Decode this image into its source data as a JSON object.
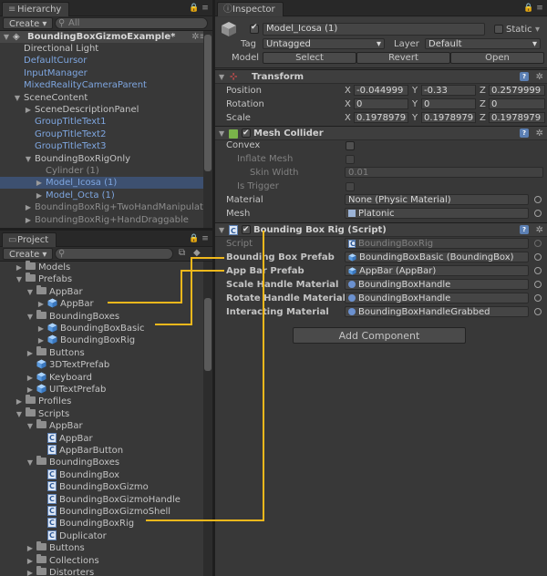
{
  "hierarchy": {
    "tab": "Hierarchy",
    "create": "Create",
    "search_placeholder": "All",
    "scene": "BoundingBoxGizmoExample*",
    "items": [
      {
        "label": "Directional Light",
        "style": "normal",
        "indent": 1
      },
      {
        "label": "DefaultCursor",
        "style": "blue",
        "indent": 1
      },
      {
        "label": "InputManager",
        "style": "blue",
        "indent": 1
      },
      {
        "label": "MixedRealityCameraParent",
        "style": "blue",
        "indent": 1
      },
      {
        "label": "SceneContent",
        "style": "normal",
        "indent": 1
      },
      {
        "label": "SceneDescriptionPanel",
        "style": "normal",
        "indent": 2
      },
      {
        "label": "GroupTitleText1",
        "style": "blue",
        "indent": 2
      },
      {
        "label": "GroupTitleText2",
        "style": "blue",
        "indent": 2
      },
      {
        "label": "GroupTitleText3",
        "style": "blue",
        "indent": 2
      },
      {
        "label": "BoundingBoxRigOnly",
        "style": "normal",
        "indent": 2
      },
      {
        "label": "Cylinder (1)",
        "style": "grey",
        "indent": 3
      },
      {
        "label": "Model_Icosa (1)",
        "style": "blue",
        "indent": 3
      },
      {
        "label": "Model_Octa (1)",
        "style": "blue",
        "indent": 3
      },
      {
        "label": "BoundingBoxRig+TwoHandManipulatable",
        "style": "grey",
        "indent": 2
      },
      {
        "label": "BoundingBoxRig+HandDraggable",
        "style": "grey",
        "indent": 2
      }
    ]
  },
  "project": {
    "tab": "Project",
    "create": "Create",
    "items": [
      {
        "label": "Models",
        "kind": "folder",
        "indent": 1
      },
      {
        "label": "Prefabs",
        "kind": "folder",
        "indent": 1
      },
      {
        "label": "AppBar",
        "kind": "folder",
        "indent": 2
      },
      {
        "label": "AppBar",
        "kind": "prefab",
        "indent": 3
      },
      {
        "label": "BoundingBoxes",
        "kind": "folder",
        "indent": 2
      },
      {
        "label": "BoundingBoxBasic",
        "kind": "prefab",
        "indent": 3
      },
      {
        "label": "BoundingBoxRig",
        "kind": "prefab",
        "indent": 3
      },
      {
        "label": "Buttons",
        "kind": "folder",
        "indent": 2
      },
      {
        "label": "3DTextPrefab",
        "kind": "prefab",
        "indent": 2
      },
      {
        "label": "Keyboard",
        "kind": "prefab",
        "indent": 2
      },
      {
        "label": "UITextPrefab",
        "kind": "prefab",
        "indent": 2
      },
      {
        "label": "Profiles",
        "kind": "folder",
        "indent": 1
      },
      {
        "label": "Scripts",
        "kind": "folder",
        "indent": 1
      },
      {
        "label": "AppBar",
        "kind": "folder",
        "indent": 2
      },
      {
        "label": "AppBar",
        "kind": "script",
        "indent": 3
      },
      {
        "label": "AppBarButton",
        "kind": "script",
        "indent": 3
      },
      {
        "label": "BoundingBoxes",
        "kind": "folder",
        "indent": 2
      },
      {
        "label": "BoundingBox",
        "kind": "script",
        "indent": 3
      },
      {
        "label": "BoundingBoxGizmo",
        "kind": "script",
        "indent": 3
      },
      {
        "label": "BoundingBoxGizmoHandle",
        "kind": "script",
        "indent": 3
      },
      {
        "label": "BoundingBoxGizmoShell",
        "kind": "script",
        "indent": 3
      },
      {
        "label": "BoundingBoxRig",
        "kind": "script",
        "indent": 3
      },
      {
        "label": "Duplicator",
        "kind": "script",
        "indent": 3
      },
      {
        "label": "Buttons",
        "kind": "folder",
        "indent": 2
      },
      {
        "label": "Collections",
        "kind": "folder",
        "indent": 2
      },
      {
        "label": "Distorters",
        "kind": "folder",
        "indent": 2
      }
    ]
  },
  "inspector": {
    "tab": "Inspector",
    "object_name": "Model_Icosa (1)",
    "static_label": "Static",
    "tag_label": "Tag",
    "tag_value": "Untagged",
    "layer_label": "Layer",
    "layer_value": "Default",
    "model_label": "Model",
    "model_buttons": [
      "Select",
      "Revert",
      "Open"
    ],
    "transform": {
      "title": "Transform",
      "rows": [
        {
          "label": "Position",
          "x": "-0.044999",
          "y": "-0.33",
          "z": "0.2579999"
        },
        {
          "label": "Rotation",
          "x": "0",
          "y": "0",
          "z": "0"
        },
        {
          "label": "Scale",
          "x": "0.1978979",
          "y": "0.1978979",
          "z": "0.1978979"
        }
      ],
      "axis": [
        "X",
        "Y",
        "Z"
      ]
    },
    "mesh_collider": {
      "title": "Mesh Collider",
      "convex": "Convex",
      "inflate": "Inflate Mesh",
      "skin_width": "Skin Width",
      "skin_value": "0.01",
      "is_trigger": "Is Trigger",
      "material_label": "Material",
      "material_value": "None (Physic Material)",
      "mesh_label": "Mesh",
      "mesh_value": "Platonic"
    },
    "bbrig": {
      "title": "Bounding Box Rig (Script)",
      "script_label": "Script",
      "script_value": "BoundingBoxRig",
      "rows": [
        {
          "label": "Bounding Box Prefab",
          "value": "BoundingBoxBasic (BoundingBox)"
        },
        {
          "label": "App Bar Prefab",
          "value": "AppBar (AppBar)"
        },
        {
          "label": "Scale Handle Material",
          "value": "BoundingBoxHandle"
        },
        {
          "label": "Rotate Handle Material",
          "value": "BoundingBoxHandle"
        },
        {
          "label": "Interacting Material",
          "value": "BoundingBoxHandleGrabbed"
        }
      ]
    },
    "add_component": "Add Component"
  },
  "colors": {
    "annotation": "#f0b81c",
    "prefab_blue": "#7ea6e0",
    "selection": "#3d5070"
  }
}
